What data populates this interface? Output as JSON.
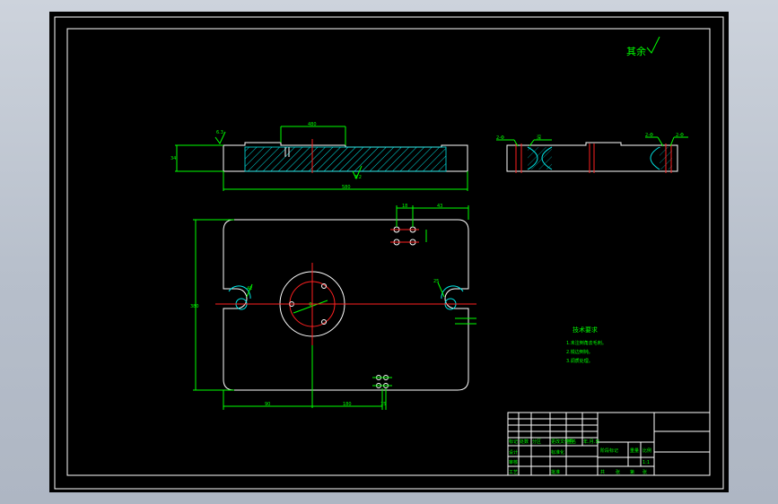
{
  "drawing": {
    "roughness_note": "其余",
    "section_dims": {
      "top_width": "480",
      "overall_length": "580",
      "height": "34",
      "roughness_left": "6.3",
      "roughness_bottom": "3.2"
    },
    "plan_dims": {
      "width_left": "90",
      "width_mid": "180",
      "width_right": "15",
      "height_total": "380",
      "top_a": "18",
      "top_b": "43",
      "slot_dim": "42",
      "circle_dim": "Φ",
      "hole_dim": "25"
    },
    "side_labels": {
      "left_a": "2-Φ",
      "left_b": "深",
      "right_a": "2-Φ",
      "right_b": "2-Φ"
    },
    "tech_req": {
      "title": "技术要求",
      "lines": [
        "1.未注倒角去毛刺。",
        "2.锐边倒钝。",
        "3.调质处理。"
      ]
    },
    "title_block": {
      "r1": [
        "标记",
        "处数",
        "分区",
        "更改文件号",
        "签名",
        "年.月.日"
      ],
      "r2": [
        "设计",
        "",
        "标准化",
        "",
        "阶段标记",
        "重量",
        "比例"
      ],
      "r3": [
        "审核",
        "",
        "",
        "",
        "",
        "",
        "1:1"
      ],
      "r4": [
        "工艺",
        "",
        "批准",
        "",
        "共",
        "张",
        "第",
        "张"
      ]
    }
  }
}
